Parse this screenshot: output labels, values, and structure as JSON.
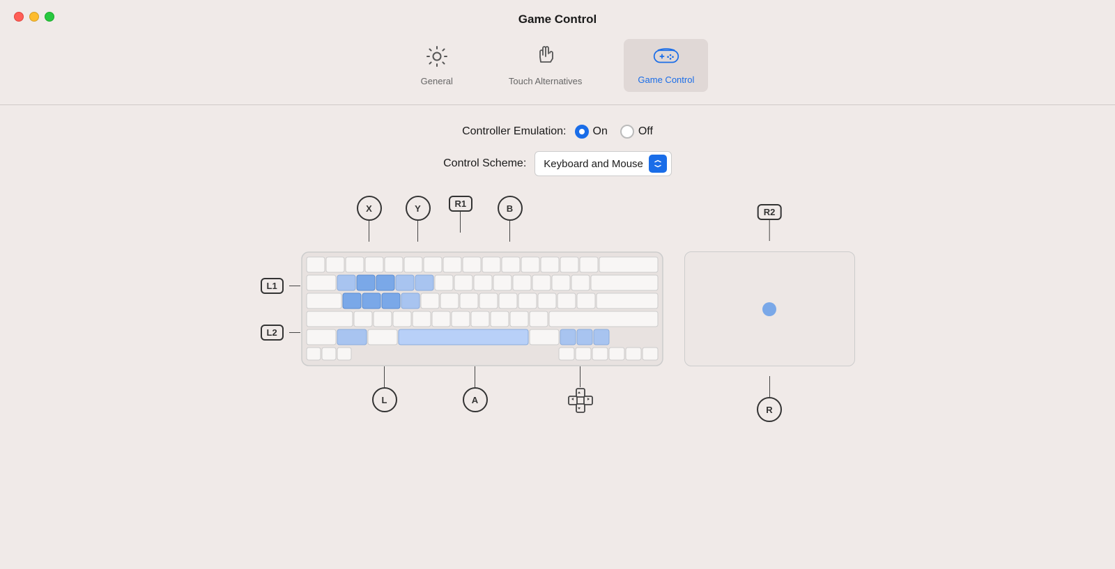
{
  "window": {
    "title": "Game Control",
    "controls": {
      "red_label": "close",
      "yellow_label": "minimize",
      "green_label": "maximize"
    }
  },
  "tabs": [
    {
      "id": "general",
      "label": "General",
      "icon": "⚙",
      "active": false
    },
    {
      "id": "touch-alternatives",
      "label": "Touch Alternatives",
      "icon": "👆",
      "active": false
    },
    {
      "id": "game-control",
      "label": "Game Control",
      "icon": "🎮",
      "active": true
    }
  ],
  "controller_emulation": {
    "label": "Controller Emulation:",
    "options": [
      {
        "value": "on",
        "label": "On",
        "selected": true
      },
      {
        "value": "off",
        "label": "Off",
        "selected": false
      }
    ]
  },
  "control_scheme": {
    "label": "Control Scheme:",
    "value": "Keyboard and Mouse"
  },
  "annotations": {
    "top": [
      {
        "label": "X",
        "circle": true
      },
      {
        "label": "Y",
        "circle": true
      },
      {
        "label": "R1",
        "circle": false
      },
      {
        "label": "B",
        "circle": true
      },
      {
        "label": "R2",
        "circle": false
      }
    ],
    "left": [
      {
        "label": "L1",
        "circle": false
      },
      {
        "label": "L2",
        "circle": false
      }
    ],
    "bottom": [
      {
        "label": "L",
        "circle": true
      },
      {
        "label": "A",
        "circle": true
      },
      {
        "label": "dpad",
        "circle": false
      },
      {
        "label": "R",
        "circle": true
      }
    ]
  }
}
